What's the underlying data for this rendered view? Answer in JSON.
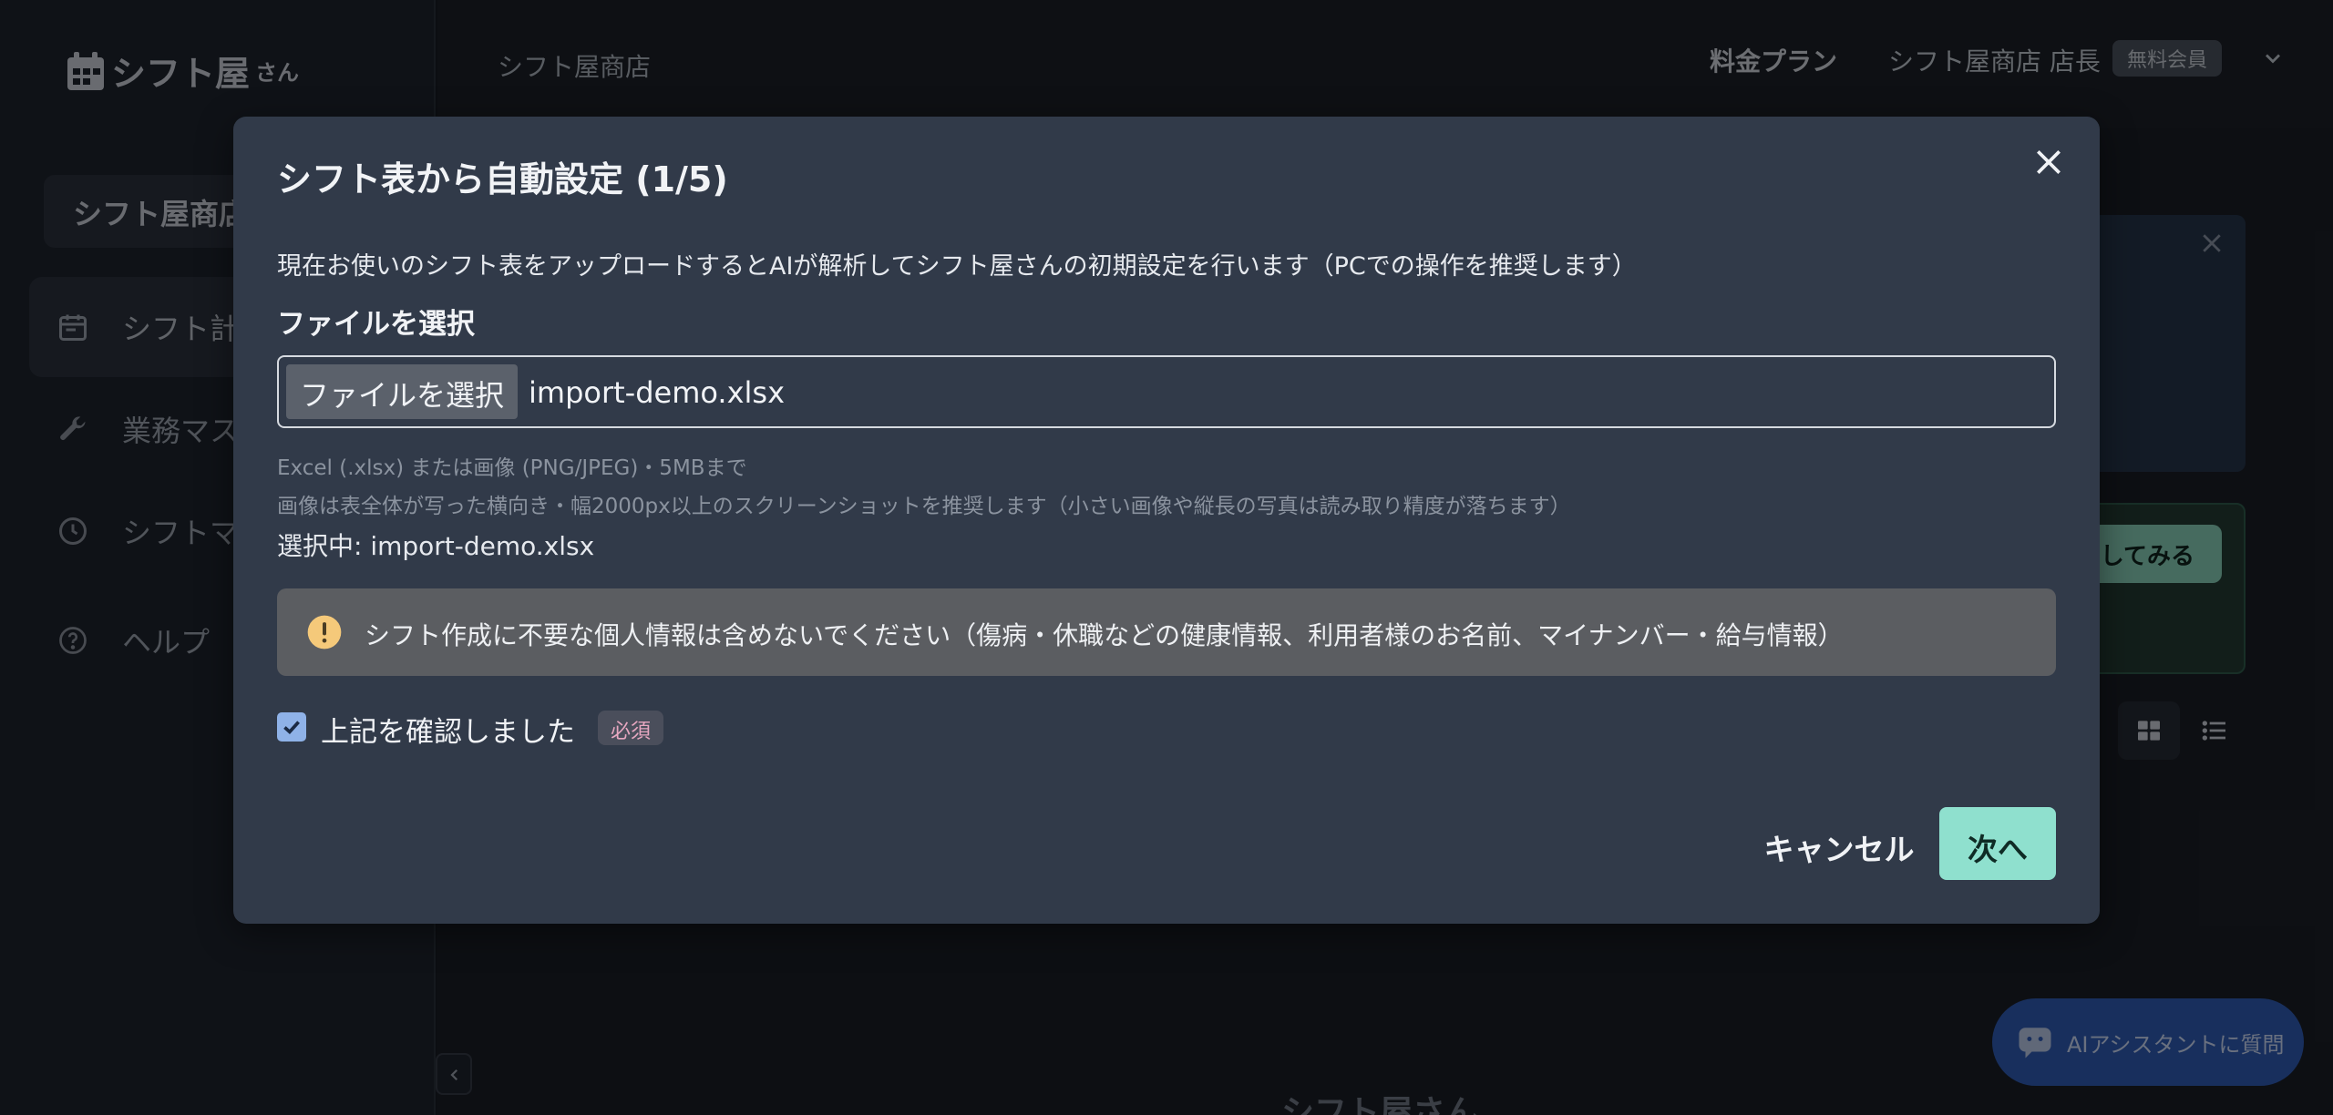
{
  "app": {
    "logo": "シフト屋",
    "logo_suffix": "さん",
    "store_selector": "シフト屋商店",
    "nav": [
      {
        "label": "シフト計",
        "icon": "calendar-icon"
      },
      {
        "label": "業務マス",
        "icon": "wrench-icon"
      },
      {
        "label": "シフトマ",
        "icon": "clock-icon"
      },
      {
        "label": "ヘルプ",
        "icon": "help-circle-icon"
      }
    ],
    "topbar": {
      "store_name": "シフト屋商店",
      "plan_link": "料金プラン",
      "user_name": "シフト屋商店 店長",
      "member_badge": "無料会員"
    },
    "background": {
      "try_button": "してみる",
      "ai_assistant": "AIアシスタントに質問",
      "footer_logo": "シフト屋さん"
    }
  },
  "modal": {
    "title": "シフト表から自動設定 (1/5)",
    "description": "現在お使いのシフト表をアップロードするとAIが解析してシフト屋さんの初期設定を行います（PCでの操作を推奨します）",
    "file_section_label": "ファイルを選択",
    "file_button": "ファイルを選択",
    "file_name": "import-demo.xlsx",
    "hint_formats": "Excel (.xlsx) または画像 (PNG/JPEG)・5MBまで",
    "hint_image": "画像は表全体が写った横向き・幅2000px以上のスクリーンショットを推奨します（小さい画像や縦長の写真は読み取り精度が落ちます）",
    "selected_text": "選択中: import-demo.xlsx",
    "warning": "シフト作成に不要な個人情報は含めないでください（傷病・休職などの健康情報、利用者様のお名前、マイナンバー・給与情報）",
    "confirm_label": "上記を確認しました",
    "required_badge": "必須",
    "cancel": "キャンセル",
    "next": "次へ"
  },
  "colors": {
    "accent": "#8fe0ce",
    "modal_bg": "#313a49",
    "warning_bg": "#5b5d61",
    "warning_icon": "#f5c97a"
  }
}
